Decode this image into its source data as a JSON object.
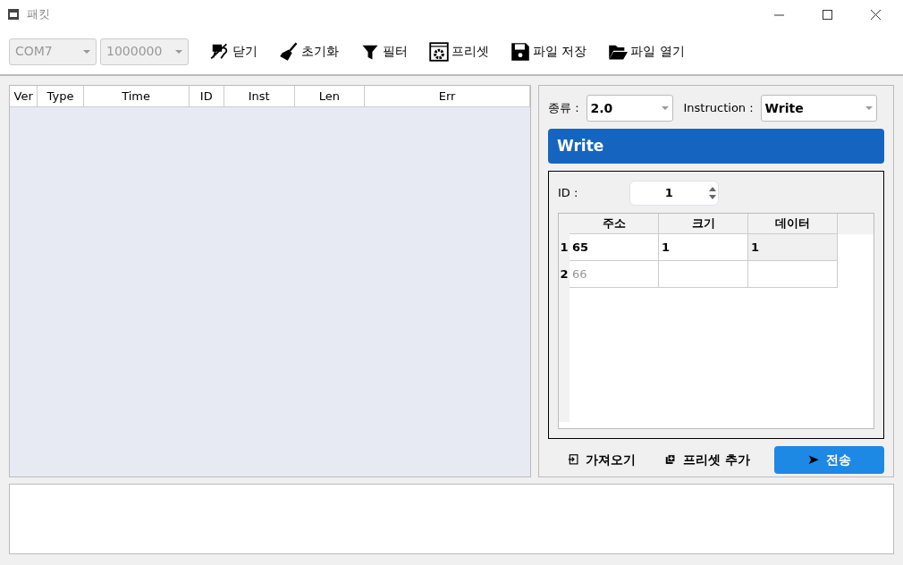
{
  "window": {
    "title": "패킷"
  },
  "toolbar": {
    "port": "COM7",
    "baud": "1000000",
    "buttons": [
      {
        "kind": "close",
        "label": "닫기"
      },
      {
        "kind": "reset",
        "label": "초기화"
      },
      {
        "kind": "filter",
        "label": "필터"
      },
      {
        "kind": "preset",
        "label": "프리셋"
      },
      {
        "kind": "save",
        "label": "파일 저장"
      },
      {
        "kind": "open",
        "label": "파일 열기"
      }
    ]
  },
  "packet_table": {
    "columns": [
      "Ver",
      "Type",
      "Time",
      "ID",
      "Inst",
      "Len",
      "Err"
    ]
  },
  "editor": {
    "type_label": "종류 :",
    "type_value": "2.0",
    "instruction_label": "Instruction :",
    "instruction_value": "Write",
    "header": "Write",
    "id_label": "ID :",
    "id_value": "1",
    "columns": [
      "주소",
      "크기",
      "데이터"
    ],
    "rows": [
      {
        "number": "1",
        "cells": [
          "65",
          "1",
          "1"
        ],
        "disabled": false
      },
      {
        "number": "2",
        "cells": [
          "66"
        ],
        "disabled": true
      }
    ],
    "buttons": [
      {
        "kind": "import",
        "label": "가져오기"
      },
      {
        "kind": "add",
        "label": "프리셋 추가"
      },
      {
        "kind": "send",
        "label": "전송"
      }
    ]
  }
}
